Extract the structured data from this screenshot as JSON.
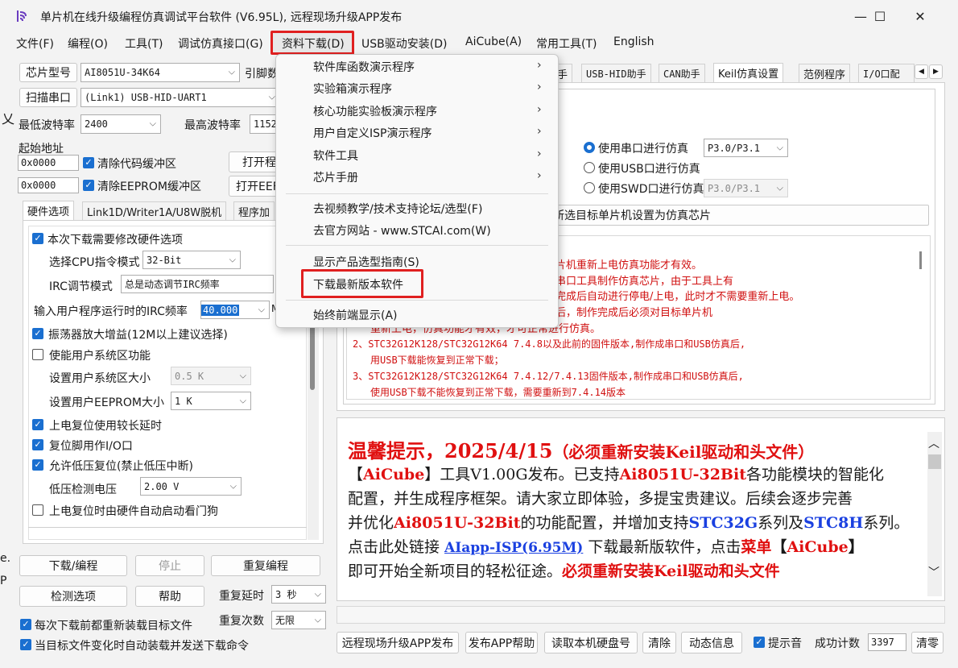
{
  "window": {
    "title": "单片机在线升级编程仿真调试平台软件 (V6.95L), 远程现场升级APP发布",
    "minimize": "—",
    "maximize": "☐",
    "close": "✕"
  },
  "menu": [
    "文件(F)",
    "编程(O)",
    "工具(T)",
    "调试仿真接口(G)",
    "资料下载(D)",
    "USB驱动安装(D)",
    "AiCube(A)",
    "常用工具(T)",
    "English"
  ],
  "left": {
    "chip_label": "芯片型号",
    "chip_value": "AI8051U-34K64",
    "pin_label": "引脚数",
    "scan_label": "扫描串口",
    "port_value": "(Link1) USB-HID-UART1",
    "min_baud_label": "最低波特率",
    "min_baud_value": "2400",
    "max_baud_label": "最高波特率",
    "max_baud_value": "1152",
    "start_addr_label": "起始地址",
    "addr1": "0x0000",
    "clear_code": "清除代码缓冲区",
    "open_prog": "打开程",
    "addr2": "0x0000",
    "clear_eeprom": "清除EEPROM缓冲区",
    "open_eep": "打开EEF",
    "tabs": [
      "硬件选项",
      "Link1D/Writer1A/U8W脱机",
      "程序加"
    ],
    "hw": {
      "modify_hw": "本次下载需要修改硬件选项",
      "cpu_mode_label": "选择CPU指令模式",
      "cpu_mode_value": "32-Bit",
      "irc_mode_label": "IRC调节模式",
      "irc_mode_value": "总是动态调节IRC频率",
      "irc_freq_label": "输入用户程序运行时的IRC频率",
      "irc_freq_value": "40.000",
      "irc_unit": "M",
      "osc_gain": "振荡器放大增益(12M以上建议选择)",
      "user_sys": "使能用户系统区功能",
      "sys_size_label": "设置用户系统区大小",
      "sys_size_value": "0.5 K",
      "eeprom_size_label": "设置用户EEPROM大小",
      "eeprom_size_value": "1   K",
      "power_reset": "上电复位使用较长延时",
      "reset_io": "复位脚用作I/O口",
      "low_volt": "允许低压复位(禁止低压中断)",
      "low_volt_label": "低压检测电压",
      "low_volt_value": "2.00 V",
      "watchdog": "上电复位时由硬件自动启动看门狗"
    },
    "download_btn": "下载/编程",
    "stop_btn": "停止",
    "reprogram_btn": "重复编程",
    "detect_btn": "检测选项",
    "help_btn": "帮助",
    "repeat_delay_label": "重复延时",
    "repeat_delay_value": "3 秒",
    "repeat_count_label": "重复次数",
    "repeat_count_value": "无限",
    "reload_each": "每次下载前都重新装载目标文件",
    "auto_reload": "当目标文件变化时自动装载并发送下载命令"
  },
  "right": {
    "tabs": [
      "手",
      "USB-HID助手",
      "CAN助手",
      "Keil仿真设置",
      "范例程序",
      "I/O口配"
    ],
    "use_serial": "使用串口进行仿真",
    "serial_pins": "P3.0/P3.1",
    "use_usb": "使用USB口进行仿真",
    "use_swd": "使用SWD口进行仿真",
    "swd_pins": "P3.0/P3.1",
    "set_chip_btn": "所选目标单片机设置为仿真芯片",
    "warnings": [
      "片机重新上电仿真功能才有效。",
      "串口工具制作仿真芯片，由于工具上有",
      "完成后自动进行停电/上电，此时才不需要重新上电。",
      "后，制作完成后必须对目标单片机",
      "重新上电，仿真功能才有效，才可正常进行仿真。",
      "2、STC32G12K128/STC32G12K64  7.4.8以及此前的固件版本,制作成串口和USB仿真后,",
      "用USB下载能恢复到正常下载；",
      "3、STC32G12K128/STC32G12K64  7.4.12/7.4.13固件版本,制作成串口和USB仿真后,",
      "使用USB下载不能恢复到正常下载，需要重新到7.4.14版本"
    ]
  },
  "news": {
    "heading": "温馨提示，2025/4/15",
    "heading_note": "（必须重新安装Keil驱动和头文件）",
    "p1_a": "【",
    "p1_b": "AiCube",
    "p1_c": "】工具V1.00G发布。已支持",
    "p1_d": "Ai8051U-32Bit",
    "p1_e": "各功能模块的智能化",
    "p2": "配置，并生成程序框架。请大家立即体验，多提宝贵建议。后续会逐步完善",
    "p3_a": "并优化",
    "p3_b": "Ai8051U-32Bit",
    "p3_c": "的功能配置，并增加支持",
    "p3_d": "STC32G",
    "p3_e": "系列及",
    "p3_f": "STC8H",
    "p3_g": "系列。",
    "p4_a": "点击此处链接 ",
    "p4_link": "AIapp-ISP(6.95M)",
    "p4_b": " 下载最新版软件，点击",
    "p4_c": "菜单",
    "p4_d": "【",
    "p4_e": "AiCube",
    "p4_f": "】",
    "p5_a": "即可开始全新项目的轻松征途。",
    "p5_b": "必须重新安装Keil驱动和头文件"
  },
  "bottom": {
    "remote_app": "远程现场升级APP发布",
    "app_help": "发布APP帮助",
    "read_disk": "读取本机硬盘号",
    "clear": "清除",
    "dyn_info": "动态信息",
    "beep": "提示音",
    "success_label": "成功计数",
    "success_count": "3397",
    "clear_count": "清零"
  },
  "dropdown": {
    "items": [
      "软件库函数演示程序",
      "实验箱演示程序",
      "核心功能实验板演示程序",
      "用户自定义ISP演示程序",
      "软件工具",
      "芯片手册"
    ],
    "video": "去视频教学/技术支持论坛/选型(F)",
    "website": "去官方网站 - www.STCAI.com(W)",
    "selection_guide": "显示产品选型指南(S)",
    "download_latest": "下载最新版本软件",
    "always_front": "始终前端显示(A)"
  },
  "edge": {
    "e": "e.",
    "p": "P",
    "x": "乂"
  },
  "colors": {
    "accent": "#1a6fd0",
    "highlight_red": "#e02020",
    "warning_text": "#d01010",
    "link_blue": "#1a40e0"
  }
}
